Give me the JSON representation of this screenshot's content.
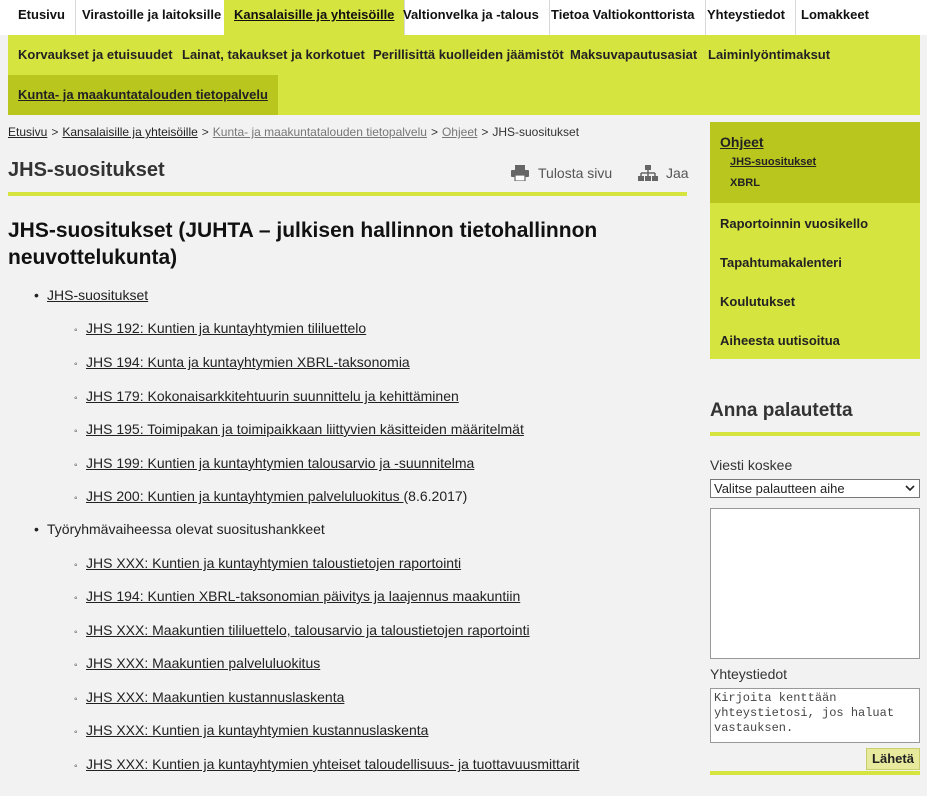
{
  "topnav": {
    "items": [
      {
        "label": "Etusivu"
      },
      {
        "label": "Virastoille ja laitoksille"
      },
      {
        "label": "Kansalaisille ja yhteisöille"
      },
      {
        "label": "Valtionvelka ja -talous"
      },
      {
        "label": "Tietoa Valtiokonttorista"
      },
      {
        "label": "Yhteystiedot"
      },
      {
        "label": "Lomakkeet"
      }
    ]
  },
  "subnav": {
    "items": [
      {
        "label": "Korvaukset ja etuisuudet"
      },
      {
        "label": "Lainat, takaukset ja korkotuet"
      },
      {
        "label": "Perillisittä kuolleiden jäämistöt"
      },
      {
        "label": "Maksuvapautusasiat"
      },
      {
        "label": "Laiminlyöntimaksut"
      },
      {
        "label": "Kunta- ja maakuntatalouden tietopalvelu"
      }
    ]
  },
  "breadcrumb": {
    "items": [
      "Etusivu",
      "Kansalaisille ja yhteisöille",
      "Kunta- ja maakuntatalouden tietopalvelu",
      "Ohjeet"
    ],
    "current": "JHS-suositukset",
    "separator": ">"
  },
  "page": {
    "title": "JHS-suositukset",
    "print_label": "Tulosta sivu",
    "share_label": "Jaa",
    "heading": "JHS-suositukset (JUHTA – julkisen hallinnon tietohallinnon neuvottelukunta)"
  },
  "content": {
    "section1": {
      "label": "JHS-suositukset",
      "items": [
        {
          "label": "JHS 192: Kuntien ja kuntayhtymien tililuettelo"
        },
        {
          "label": "JHS 194: Kunta ja kuntayhtymien XBRL-taksonomia"
        },
        {
          "label": "JHS 179: Kokonaisarkkitehtuurin suunnittelu ja kehittäminen"
        },
        {
          "label": "JHS 195: Toimipakan ja toimipaikkaan liittyvien käsitteiden määritelmät"
        },
        {
          "label": "JHS 199: Kuntien ja kuntayhtymien talousarvio ja -suunnitelma"
        },
        {
          "label": "JHS 200: Kuntien ja kuntayhtymien palveluluokitus ",
          "suffix": " (8.6.2017)"
        }
      ]
    },
    "section2": {
      "label": "Työryhmävaiheessa olevat suositushankkeet",
      "items": [
        {
          "label": "JHS XXX: Kuntien ja kuntayhtymien taloustietojen raportointi "
        },
        {
          "label": "JHS 194: Kuntien XBRL-taksonomian päivitys ja laajennus maakuntiin"
        },
        {
          "label": "JHS XXX: Maakuntien tililuettelo, talousarvio ja taloustietojen raportointi"
        },
        {
          "label": "JHS XXX: Maakuntien palveluluokitus"
        },
        {
          "label": "JHS XXX: Maakuntien kustannuslaskenta"
        },
        {
          "label": "JHS XXX: Kuntien ja kuntayhtymien kustannuslaskenta"
        },
        {
          "label": "JHS XXX: Kuntien ja kuntayhtymien yhteiset taloudellisuus- ja tuottavuusmittarit"
        }
      ]
    }
  },
  "sidebar": {
    "active_section": "Ohjeet",
    "sub_items": [
      {
        "label": "JHS-suositukset"
      },
      {
        "label": "XBRL"
      }
    ],
    "items": [
      {
        "label": "Raportoinnin vuosikello"
      },
      {
        "label": "Tapahtumakalenteri"
      },
      {
        "label": "Koulutukset"
      },
      {
        "label": "Aiheesta uutisoitua"
      }
    ]
  },
  "feedback": {
    "title": "Anna palautetta",
    "topic_label": "Viesti koskee",
    "topic_selected": "Valitse palautteen aihe",
    "message_value": "",
    "contact_label": "Yhteystiedot",
    "contact_placeholder": "Kirjoita kenttään yhteystietosi, jos haluat vastauksen.",
    "send_label": "Lähetä"
  },
  "colors": {
    "accent": "#d6e43f",
    "accent_dark": "#b9c61e",
    "background": "#f2f2f2"
  },
  "icons": {
    "print": "printer-icon",
    "share": "share-icon",
    "select": "chevron-down-icon"
  }
}
